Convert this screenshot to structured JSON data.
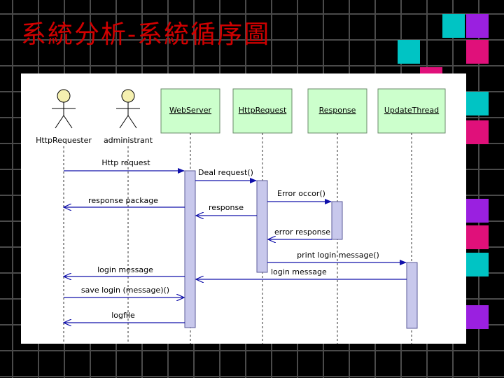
{
  "slide": {
    "title": "系統分析-系統循序圖"
  },
  "theme": {
    "background": "#000000",
    "grid_line": "#4a4a4a",
    "title_color": "#d00000",
    "object_fill": "#ccffcc",
    "lifeline_fill": "#c8c8ec",
    "message_color": "#1010aa"
  },
  "diagram": {
    "actors": [
      {
        "name": "HttpRequester"
      },
      {
        "name": "administrant"
      }
    ],
    "objects": [
      {
        "name": "WebServer"
      },
      {
        "name": "HttpRequest"
      },
      {
        "name": "Response"
      },
      {
        "name": "UpdateThread"
      }
    ],
    "messages": [
      {
        "label": "Http request",
        "from": "HttpRequester",
        "to": "WebServer",
        "kind": "call"
      },
      {
        "label": "Deal request()",
        "from": "WebServer",
        "to": "HttpRequest",
        "kind": "call"
      },
      {
        "label": "Error occor()",
        "from": "HttpRequest",
        "to": "Response",
        "kind": "call"
      },
      {
        "label": "response package",
        "from": "WebServer",
        "to": "HttpRequester",
        "kind": "return"
      },
      {
        "label": "response",
        "from": "HttpRequest",
        "to": "WebServer",
        "kind": "return"
      },
      {
        "label": "error response",
        "from": "Response",
        "to": "HttpRequest",
        "kind": "return"
      },
      {
        "label": "print login message()",
        "from": "HttpRequest",
        "to": "UpdateThread",
        "kind": "call"
      },
      {
        "label": "login message",
        "from": "WebServer",
        "to": "HttpRequester",
        "kind": "return"
      },
      {
        "label": "login message",
        "from": "UpdateThread",
        "to": "WebServer",
        "kind": "return"
      },
      {
        "label": "save login (message)()",
        "from": "HttpRequester",
        "to": "WebServer",
        "kind": "return"
      },
      {
        "label": "logfile",
        "from": "WebServer",
        "to": "HttpRequester",
        "kind": "return"
      }
    ]
  }
}
